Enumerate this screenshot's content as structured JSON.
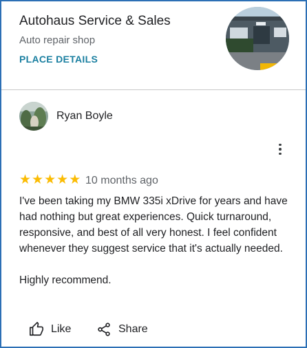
{
  "place": {
    "name": "Autohaus Service & Sales",
    "category": "Auto repair shop",
    "details_link": "PLACE DETAILS"
  },
  "review": {
    "author": "Ryan Boyle",
    "rating": 5,
    "rating_max": 5,
    "time_ago": "10 months ago",
    "paragraphs": [
      "I've been taking my BMW 335i xDrive for years and have had nothing but great experiences. Quick turnaround, responsive, and best of all very honest. I feel confident whenever they suggest service that it's actually needed.",
      "Highly recommend."
    ]
  },
  "actions": {
    "like_label": "Like",
    "share_label": "Share"
  },
  "icons": {
    "more": "more-vert-icon",
    "like": "thumbs-up-icon",
    "share": "share-icon",
    "star": "star-icon"
  },
  "colors": {
    "link": "#1a7fa0",
    "star": "#fbbc04",
    "frame_border": "#2b6fb5",
    "secondary_text": "#5f6368"
  }
}
